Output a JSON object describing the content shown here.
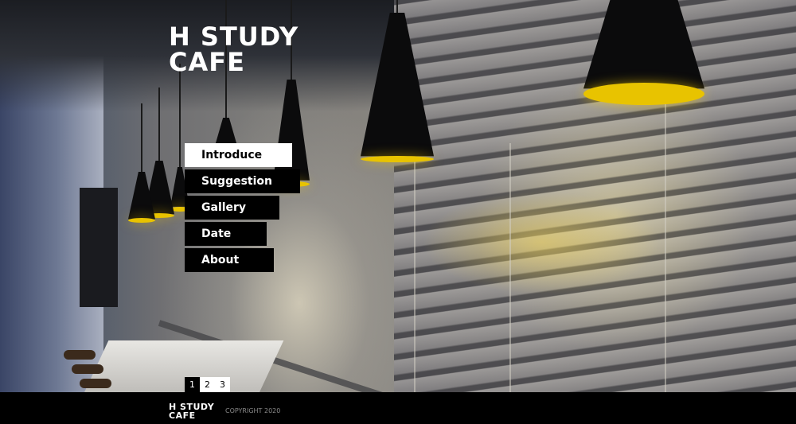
{
  "logo": {
    "line1": "H STUDY",
    "line2": "CAFE"
  },
  "menu": {
    "items": [
      {
        "label": "Introduce",
        "active": true
      },
      {
        "label": "Suggestion",
        "active": false
      },
      {
        "label": "Gallery",
        "active": false
      },
      {
        "label": "Date",
        "active": false
      },
      {
        "label": "About",
        "active": false
      }
    ]
  },
  "pager": {
    "pages": [
      "1",
      "2",
      "3"
    ],
    "current": "1"
  },
  "footer": {
    "logo_line1": "H STUDY",
    "logo_line2": "CAFE",
    "copyright": "COPYRIGHT 2020"
  },
  "colors": {
    "accent": "#000000",
    "lamp_glow": "#e8c300",
    "menu_active_bg": "#ffffff"
  }
}
